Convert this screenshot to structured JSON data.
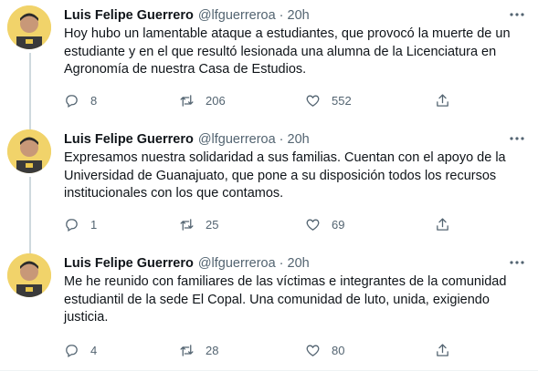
{
  "tweets": [
    {
      "name": "Luis Felipe Guerrero",
      "handle": "@lfguerreroa",
      "separator": "·",
      "time": "20h",
      "text": "Hoy hubo un lamentable ataque a estudiantes, que provocó la muerte de un estudiante y en el que resultó lesionada una alumna de la Licenciatura en Agronomía de nuestra Casa de Estudios.",
      "replies": "8",
      "retweets": "206",
      "likes": "552"
    },
    {
      "name": "Luis Felipe Guerrero",
      "handle": "@lfguerreroa",
      "separator": "·",
      "time": "20h",
      "text": "Expresamos nuestra solidaridad a sus familias. Cuentan con el apoyo de la Universidad de Guanajuato, que pone a su disposición todos los recursos institucionales con los que contamos.",
      "replies": "1",
      "retweets": "25",
      "likes": "69"
    },
    {
      "name": "Luis Felipe Guerrero",
      "handle": "@lfguerreroa",
      "separator": "·",
      "time": "20h",
      "text": "Me he reunido con familiares de las víctimas e integrantes de la comunidad estudiantil de la sede El Copal. Una comunidad de luto, unida, exigiendo justicia.",
      "replies": "4",
      "retweets": "28",
      "likes": "80"
    }
  ],
  "icons": {
    "reply": "reply-icon",
    "retweet": "retweet-icon",
    "like": "like-icon",
    "share": "share-icon",
    "more": "more-icon"
  },
  "colors": {
    "text": "#0f1419",
    "muted": "#536471",
    "thread_line": "#cfd9de"
  }
}
